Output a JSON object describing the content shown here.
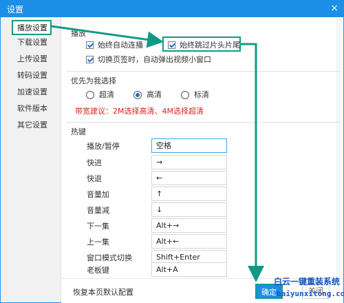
{
  "window": {
    "title": "设置",
    "close_label": "×"
  },
  "sidebar": {
    "items": [
      {
        "label": "播放设置",
        "active": true
      },
      {
        "label": "下载设置",
        "active": false
      },
      {
        "label": "上传设置",
        "active": false
      },
      {
        "label": "转码设置",
        "active": false
      },
      {
        "label": "加速设置",
        "active": false
      },
      {
        "label": "软件版本",
        "active": false
      },
      {
        "label": "其它设置",
        "active": false
      }
    ]
  },
  "playback": {
    "section_title": "播放",
    "auto_continue": {
      "label": "始终自动连播",
      "checked": true
    },
    "skip_intro": {
      "label": "始终跳过片头片尾",
      "checked": true
    },
    "popup_small": {
      "label": "切换页签时，自动弹出视频小窗口",
      "checked": true
    }
  },
  "quality": {
    "section_title": "优先为我选择",
    "options": [
      {
        "label": "超清",
        "selected": false
      },
      {
        "label": "高清",
        "selected": true
      },
      {
        "label": "标清",
        "selected": false
      }
    ],
    "tip": "带宽建议：2M选择高清、4M选择超清"
  },
  "hotkeys": {
    "section_title": "热键",
    "rows": [
      {
        "label": "播放/暂停",
        "value": "空格"
      },
      {
        "label": "快进",
        "value": "→"
      },
      {
        "label": "快退",
        "value": "←"
      },
      {
        "label": "音量加",
        "value": "↑"
      },
      {
        "label": "音量减",
        "value": "↓"
      },
      {
        "label": "下一集",
        "value": "Alt+→"
      },
      {
        "label": "上一集",
        "value": "Alt+←"
      },
      {
        "label": "窗口模式切换",
        "value": "Shift+Enter"
      },
      {
        "label": "老板键",
        "value": "Alt+A"
      }
    ]
  },
  "footer": {
    "reset_label": "恢复本页默认配置",
    "ok_label": "确定",
    "close_label": "关闭"
  },
  "watermark": {
    "top": "白云一键重装系统",
    "bottom": "baiyunxitong.com"
  },
  "colors": {
    "titlebar": "#1d8fe6",
    "highlight": "#0f9b83",
    "tip": "#d9251c"
  }
}
